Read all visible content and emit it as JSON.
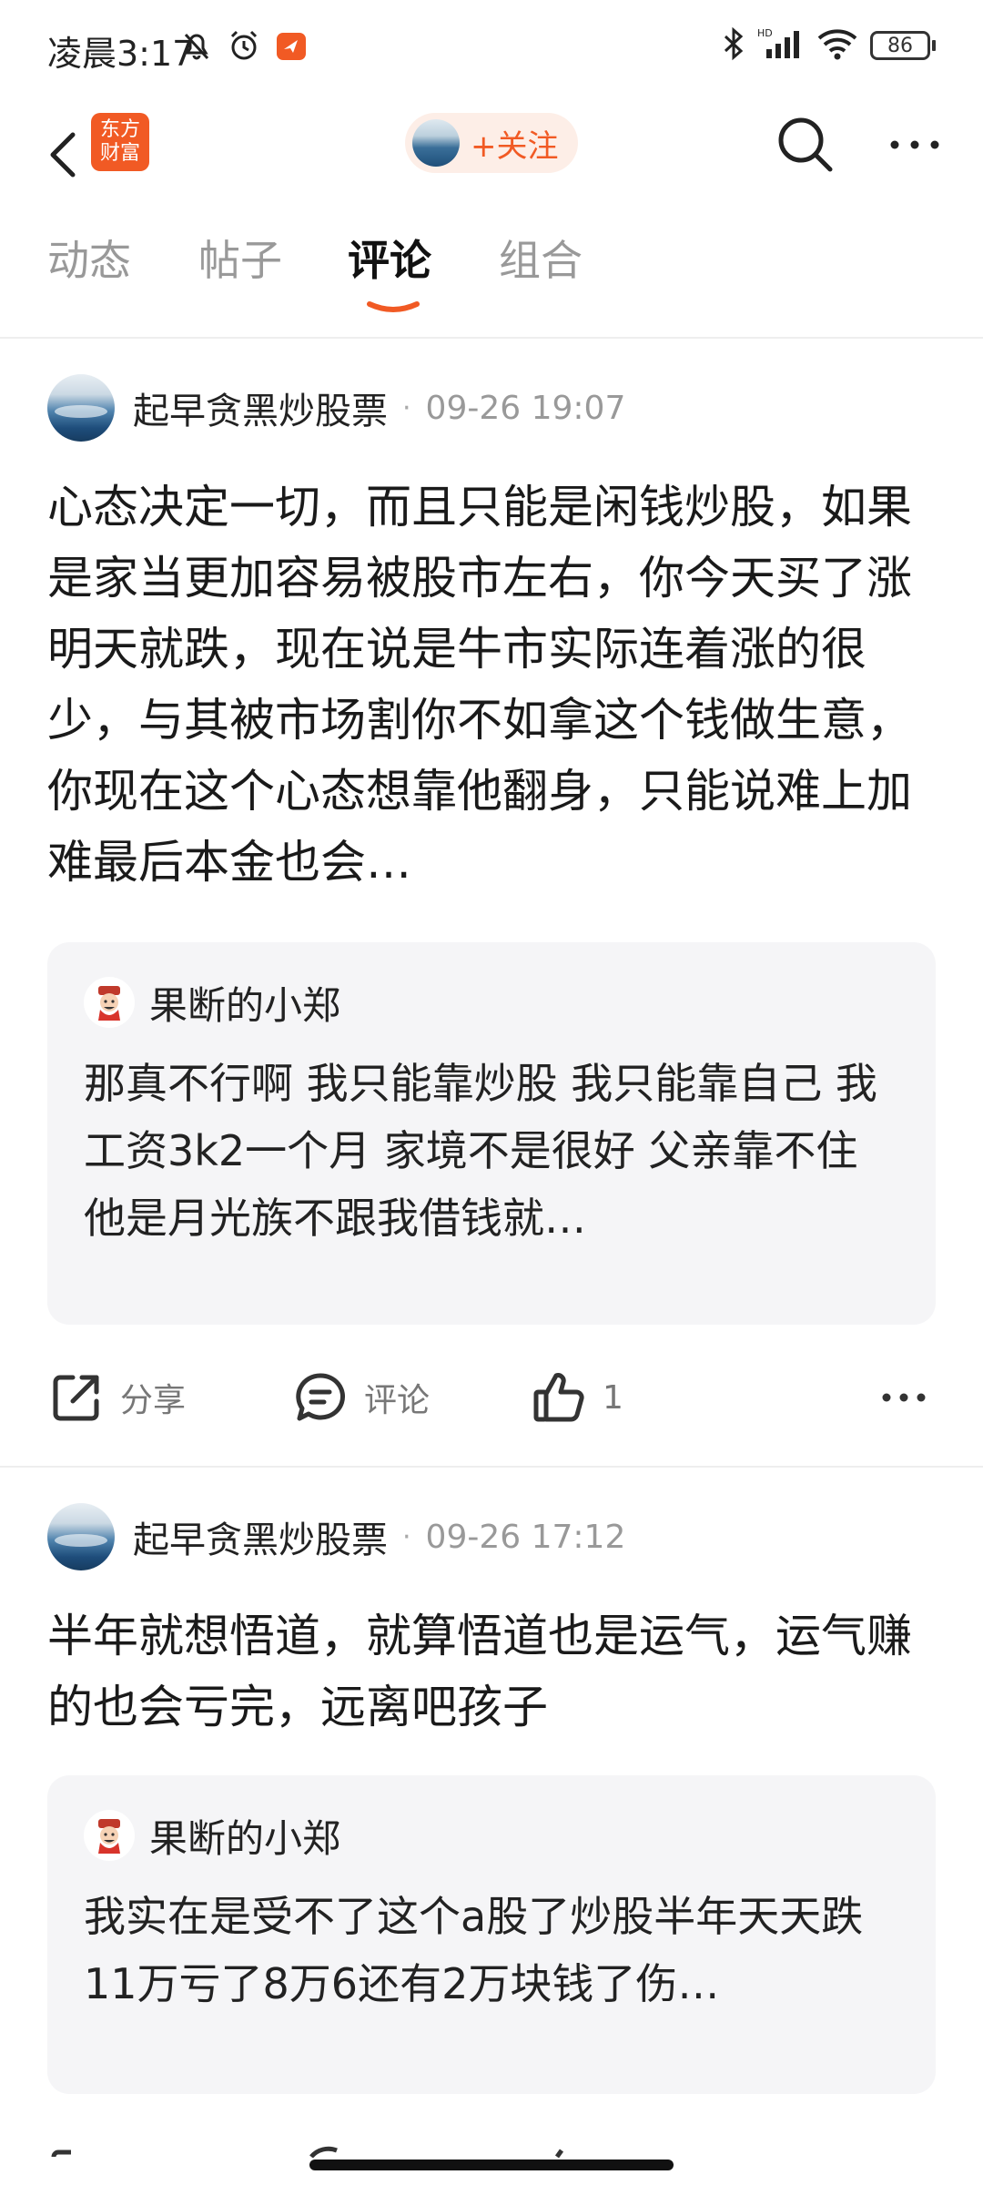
{
  "status_bar": {
    "time": "凌晨3:17",
    "battery": "86",
    "icons": [
      "mute-bell-icon",
      "alarm-icon",
      "app-notification-icon",
      "bluetooth-icon",
      "hd-signal-icon",
      "wifi-icon",
      "battery-icon"
    ]
  },
  "nav": {
    "app_logo_text": "东方财富",
    "follow_label": "+关注"
  },
  "tabs": [
    {
      "label": "动态",
      "active": false
    },
    {
      "label": "帖子",
      "active": false
    },
    {
      "label": "评论",
      "active": true
    },
    {
      "label": "组合",
      "active": false
    }
  ],
  "comments": [
    {
      "author": "起早贪黑炒股票",
      "time": "09-26 19:07",
      "text": "心态决定一切，而且只能是闲钱炒股，如果是家当更加容易被股市左右，你今天买了涨明天就跌，现在说是牛市实际连着涨的很少，与其被市场割你不如拿这个钱做生意，你现在这个心态想靠他翻身，只能说难上加难最后本金也会…",
      "quote": {
        "author": "果断的小郑",
        "text": "那真不行啊 我只能靠炒股 我只能靠自己 我工资3k2一个月 家境不是很好 父亲靠不住 他是月光族不跟我借钱就…"
      },
      "actions": {
        "share_label": "分享",
        "comment_label": "评论",
        "like_count": "1"
      }
    },
    {
      "author": "起早贪黑炒股票",
      "time": "09-26 17:12",
      "text": "半年就想悟道，就算悟道也是运气，运气赚的也会亏完，远离吧孩子",
      "quote": {
        "author": "果断的小郑",
        "text": "我实在是受不了这个a股了炒股半年天天跌11万亏了8万6还有2万块钱了伤…"
      }
    }
  ],
  "colors": {
    "accent": "#f15a24",
    "follow_bg": "#fdeee7",
    "quote_bg": "#f5f5f7"
  }
}
